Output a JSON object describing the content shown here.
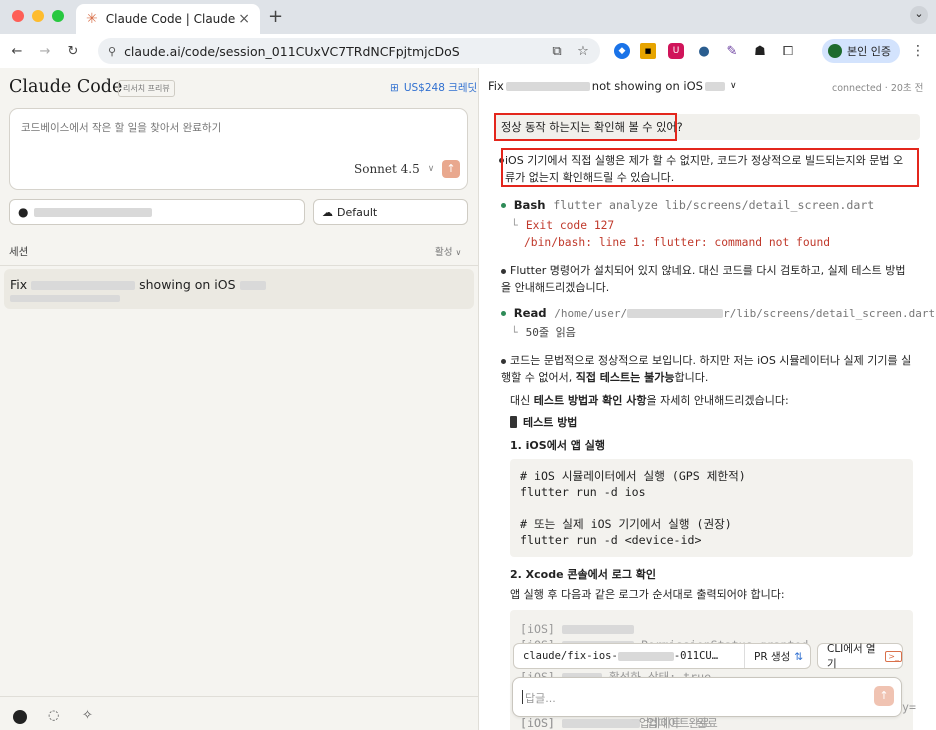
{
  "browser": {
    "tab_title": "Claude Code | Claude",
    "tab_close": "×",
    "new_tab": "+",
    "url": "claude.ai/code/session_011CUxVC7TRdNCFpjtmjcDoS",
    "verify_button": "본인 인증",
    "tab_menu": "⌄"
  },
  "left": {
    "app_title": "Claude Code",
    "preview_badge": "리서치 프리뷰",
    "credit": "US$248 크레딧",
    "composer_placeholder": "코드베이스에서 작은 할 일을 찾아서 완료하기",
    "model": "Sonnet 4.5",
    "repo_chip": "",
    "default_chip": "Default",
    "sessions_label": "세션",
    "filter_label": "활성",
    "session_title_start": "Fix",
    "session_title_mid": "showing on iOS"
  },
  "right": {
    "header_title_start": "Fix",
    "header_title_mid": "not showing on iOS",
    "status": "connected",
    "time": "20초 전",
    "user_msg": "정상 동작 하는지는 확인해 볼 수 있어?",
    "assist1": "iOS 기기에서 직접 실행은 제가 할 수 없지만, 코드가 정상적으로 빌드되는지와 문법 오류가 없는지 확인해드릴 수 있습니다.",
    "bash_label": "Bash",
    "bash_cmd": "flutter analyze lib/screens/detail_screen.dart",
    "bash_out1": "Exit code 127",
    "bash_out2": "/bin/bash: line 1: flutter: command not found",
    "assist2": "Flutter 명령어가 설치되어 있지 않네요. 대신 코드를 다시 검토하고, 실제 테스트 방법을 안내해드리겠습니다.",
    "read_label": "Read",
    "read_path_start": "/home/user/",
    "read_path_end": "r/lib/screens/detail_screen.dart",
    "read_out": "50줄 읽음",
    "assist3a": "코드는 문법적으로 정상적으로 보입니다. 하지만 저는 iOS 시뮬레이터나 실제 기기를 실행할 수 없어서, ",
    "assist3b": "직접 테스트는 불가능",
    "assist3c": "합니다.",
    "assist4a": "대신 ",
    "assist4b": "테스트 방법과 확인 사항",
    "assist4c": "을 자세히 안내해드리겠습니다:",
    "h_test": "테스트 방법",
    "h_step1": "1. iOS에서 앱 실행",
    "code1": [
      "# iOS 시뮬레이터에서 실행 (GPS 제한적)",
      "flutter run -d ios",
      "",
      "# 또는 실제 iOS 기기에서 실행 (권장)",
      "flutter run -d <device-id>"
    ],
    "h_step2": "2. Xcode 콘솔에서 로그 확인",
    "step2_text": "앱 실행 후 다음과 같은 로그가 순서대로 출력되어야 합니다:",
    "log_prefix": "[iOS]",
    "log2_tail": "PermissionStatus.granted",
    "log3_tail": "활성화 상태: true",
    "log4_tail": "업데이트 완료",
    "log_clip": "y=",
    "branch": "claude/fix-ios-",
    "branch_tail": "-011CU…",
    "pr_button": "PR 생성",
    "cli_button": "CLI에서 열기",
    "reply_placeholder": "답글..."
  }
}
